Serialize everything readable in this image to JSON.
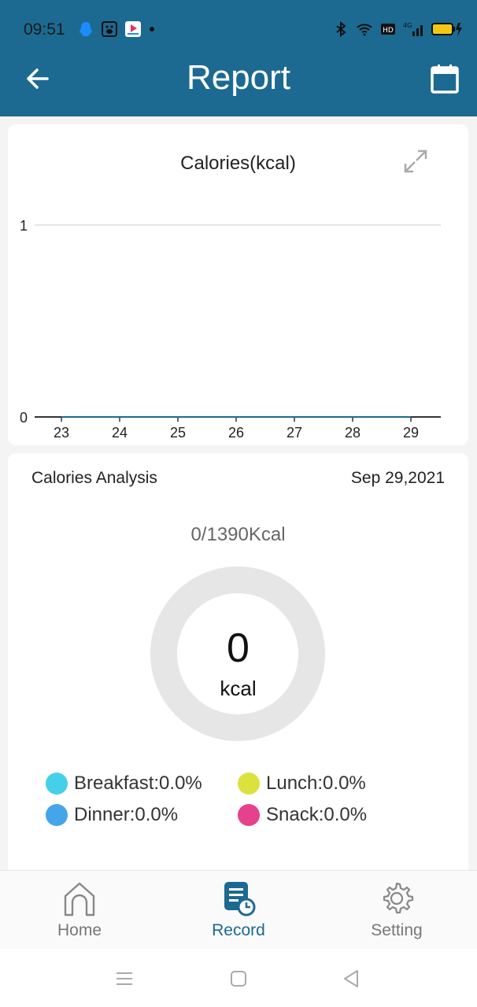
{
  "status_bar": {
    "time": "09:51",
    "left_icons": [
      "qq-icon",
      "baidu-icon",
      "youku-icon",
      "dot-icon"
    ],
    "right_icons": [
      "bluetooth-icon",
      "wifi-icon",
      "hd-icon",
      "signal-4g-icon",
      "battery-icon"
    ]
  },
  "header": {
    "title": "Report",
    "back_icon": "arrow-left-icon",
    "calendar_icon": "calendar-icon"
  },
  "chart_card": {
    "chart_data": {
      "type": "line",
      "title": "Calories(kcal)",
      "x": [
        "23",
        "24",
        "25",
        "26",
        "27",
        "28",
        "29"
      ],
      "series": [
        {
          "values": [
            0,
            0,
            0,
            0,
            0,
            0,
            0
          ]
        }
      ],
      "yticks": [
        "0",
        "1"
      ],
      "ylim": [
        0,
        1
      ],
      "grid": true
    },
    "expand_icon": "expand-icon"
  },
  "analysis": {
    "title": "Calories Analysis",
    "date": "Sep 29,2021",
    "target": "0/1390Kcal",
    "value": "0",
    "unit": "kcal",
    "donut_fill": 0,
    "legend": [
      {
        "label": "Breakfast:0.0%",
        "color": "#45d0ea"
      },
      {
        "label": "Lunch:0.0%",
        "color": "#dde13c"
      },
      {
        "label": "Dinner:0.0%",
        "color": "#45a5ea"
      },
      {
        "label": "Snack:0.0%",
        "color": "#e6418c"
      }
    ]
  },
  "bottom_nav": {
    "items": [
      {
        "label": "Home",
        "icon": "home-icon",
        "active": false
      },
      {
        "label": "Record",
        "icon": "record-icon",
        "active": true
      },
      {
        "label": "Setting",
        "icon": "gear-icon",
        "active": false
      }
    ]
  },
  "system_bar": {
    "icons": [
      "menu-icon",
      "home-square-icon",
      "back-triangle-icon"
    ]
  },
  "colors": {
    "primary": "#1c6a91",
    "donut_track": "#e6e6e6"
  }
}
